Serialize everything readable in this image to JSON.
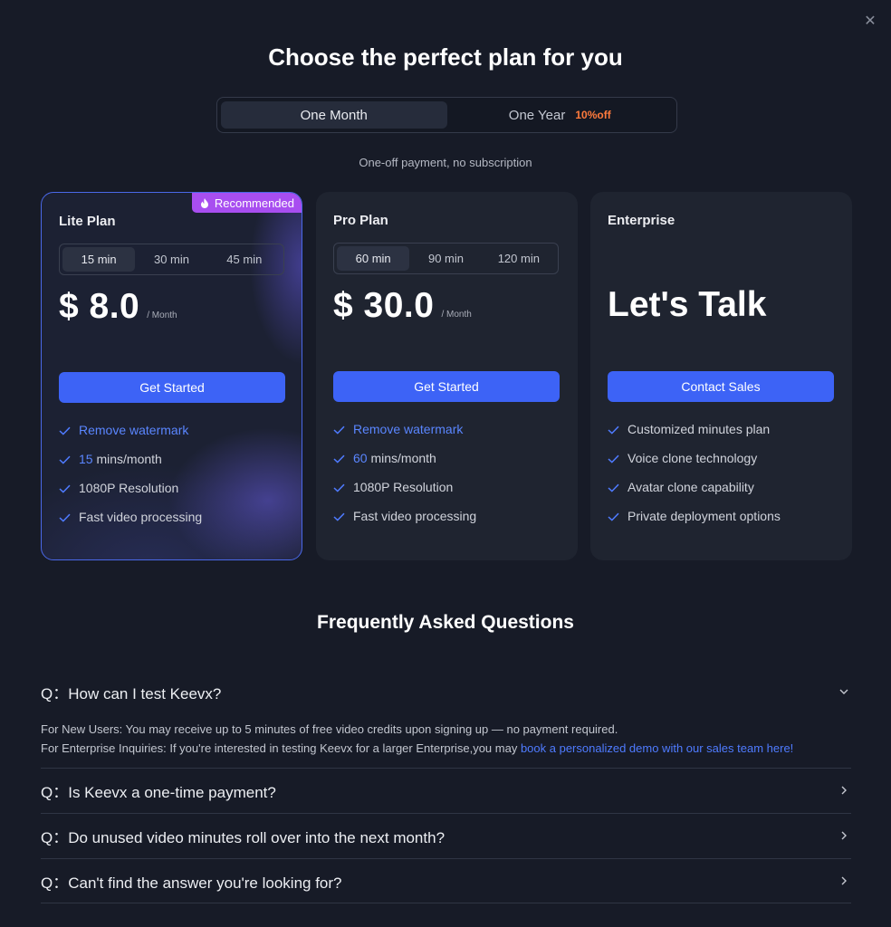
{
  "modal": {
    "close_icon": "close-icon",
    "title": "Choose the perfect plan for you"
  },
  "billing": {
    "options": [
      "One Month",
      "One Year"
    ],
    "selected": "One Month",
    "discount": "10%off",
    "note": "One-off payment, no subscription"
  },
  "plans": [
    {
      "name": "Lite Plan",
      "badge": "Recommended",
      "badge_icon": "fire-icon",
      "minute_options": [
        "15 min",
        "30 min",
        "45 min"
      ],
      "selected_minutes": "15 min",
      "price": "$ 8.0",
      "price_unit": "/ Month",
      "cta": "Get Started",
      "features": [
        {
          "text": "Remove watermark"
        },
        {
          "highlight": "15",
          "text": " mins/month"
        },
        {
          "text": "1080P Resolution"
        },
        {
          "text": "Fast video processing"
        }
      ]
    },
    {
      "name": "Pro Plan",
      "minute_options": [
        "60 min",
        "90 min",
        "120 min"
      ],
      "selected_minutes": "60 min",
      "price": "$ 30.0",
      "price_unit": "/ Month",
      "cta": "Get Started",
      "features": [
        {
          "text": "Remove watermark"
        },
        {
          "highlight": "60",
          "text": " mins/month"
        },
        {
          "text": "1080P Resolution"
        },
        {
          "text": "Fast video processing"
        }
      ]
    },
    {
      "name": "Enterprise",
      "headline": "Let's Talk",
      "cta": "Contact Sales",
      "features": [
        {
          "text": "Customized minutes plan"
        },
        {
          "text": "Voice clone technology"
        },
        {
          "text": "Avatar clone capability"
        },
        {
          "text": "Private deployment options"
        }
      ]
    }
  ],
  "faq": {
    "title": "Frequently Asked Questions",
    "items": [
      {
        "question": "Q：How can I test Keevx?",
        "expanded": true,
        "answer_line1": "For New Users: You may receive up to 5 minutes of free video credits upon signing up — no payment required.",
        "answer_line2": "For Enterprise Inquiries: If you're interested in testing Keevx for a larger Enterprise,you may ",
        "answer_link": "book a personalized demo with our sales team here!"
      },
      {
        "question": "Q：Is Keevx a one-time payment?",
        "expanded": false
      },
      {
        "question": "Q：Do unused video minutes roll over into the next month?",
        "expanded": false
      },
      {
        "question": "Q：Can't find the answer you're looking for?",
        "expanded": false
      }
    ]
  },
  "colors": {
    "background": "#171b27",
    "accent": "#3d63f6",
    "badge": "#a84ef0",
    "discount": "#ff7a3c",
    "highlight": "#5a86ff"
  }
}
